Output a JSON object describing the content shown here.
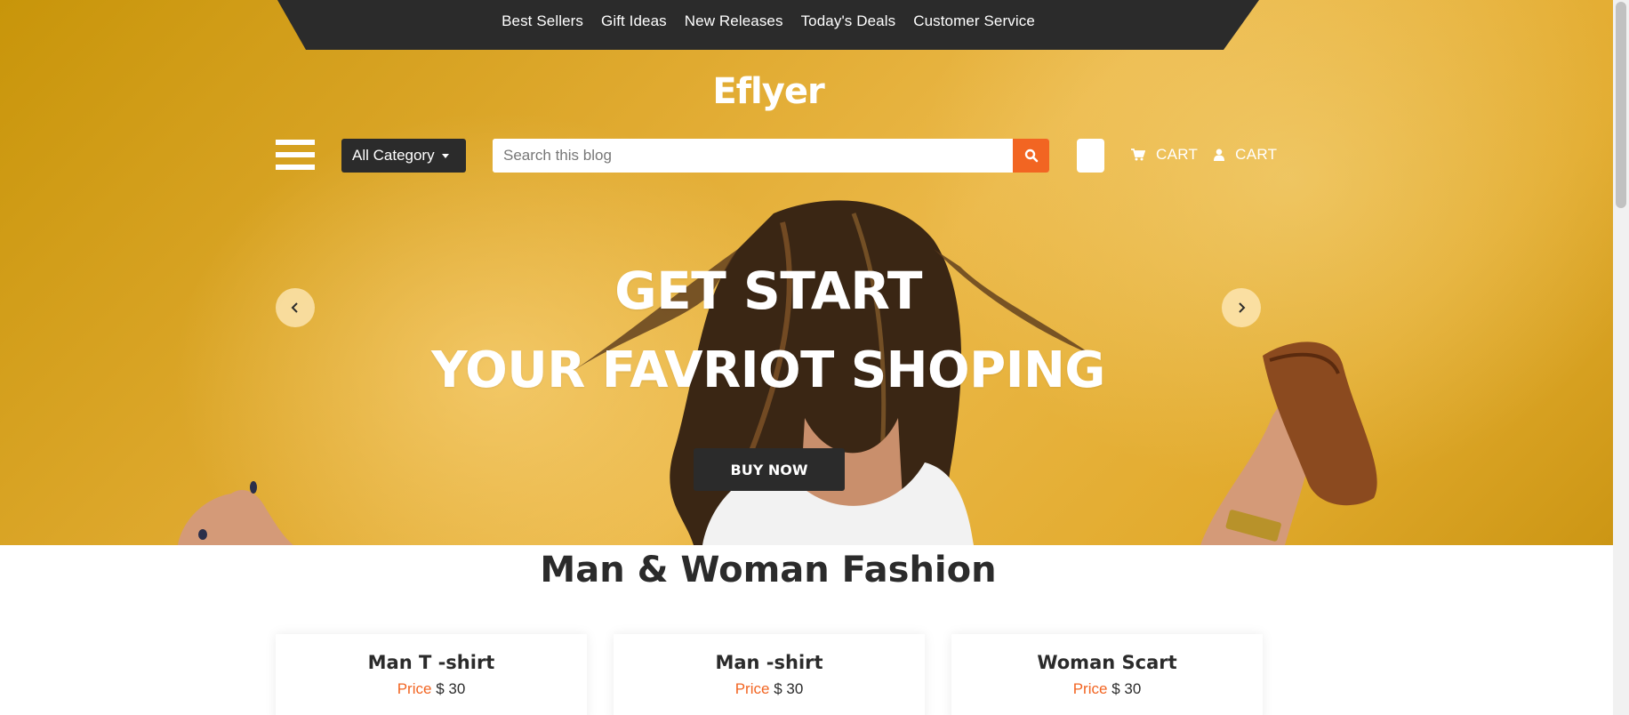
{
  "topnav": {
    "links": [
      "Best Sellers",
      "Gift Ideas",
      "New Releases",
      "Today's Deals",
      "Customer Service"
    ]
  },
  "brand": {
    "logo": "Eflyer"
  },
  "toolbar": {
    "category_label": "All Category",
    "search_placeholder": "Search this blog",
    "cart_label": "CART",
    "account_label": "CART"
  },
  "hero": {
    "title_line1": "GET START",
    "title_line2": "YOUR FAVRIOT SHOPING",
    "cta": "BUY NOW"
  },
  "section": {
    "title": "Man & Woman Fashion"
  },
  "products": [
    {
      "name": "Man T -shirt",
      "price_label": "Price",
      "price": "$ 30"
    },
    {
      "name": "Man -shirt",
      "price_label": "Price",
      "price": "$ 30"
    },
    {
      "name": "Woman Scart",
      "price_label": "Price",
      "price": "$ 30"
    }
  ],
  "colors": {
    "accent": "#f26522",
    "dark": "#2b2b2b",
    "hero_yellow": "#e3ac31"
  },
  "icons": {
    "search": "search-icon",
    "cart": "cart-icon",
    "user": "user-icon",
    "menu": "hamburger-icon",
    "prev": "chevron-left-icon",
    "next": "chevron-right-icon"
  }
}
